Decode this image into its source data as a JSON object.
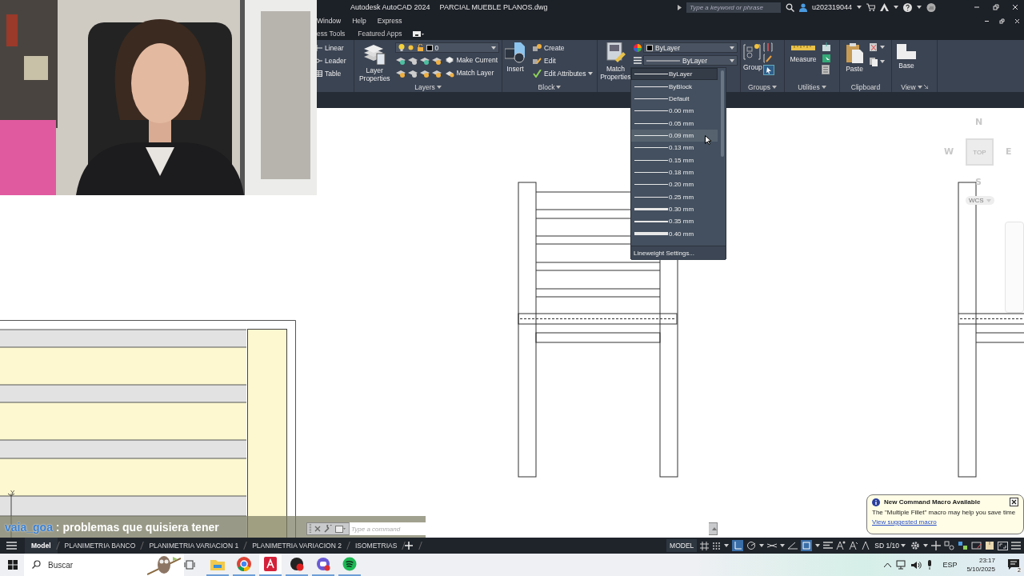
{
  "title_bar": {
    "app": "Autodesk AutoCAD 2024",
    "file": "PARCIAL MUEBLE PLANOS.dwg",
    "search": {
      "placeholder": "Type a keyword or phrase"
    },
    "user": "u202319044"
  },
  "menu": [
    "Window",
    "Help",
    "Express"
  ],
  "ribbon_tabs": [
    {
      "label": "ess Tools",
      "selected": false
    },
    {
      "label": "Featured Apps",
      "selected": false
    }
  ],
  "ribbon": {
    "annotation": {
      "tools": [
        "Linear",
        "Leader",
        "Table"
      ]
    },
    "layers": {
      "title": "Layers",
      "properties": "Layer Properties",
      "layer": "0",
      "make_current": "Make Current",
      "match_layer": "Match Layer"
    },
    "block": {
      "title": "Block",
      "insert": "Insert",
      "tools": [
        "Create",
        "Edit",
        "Edit Attributes"
      ]
    },
    "properties": {
      "match": "Match Properties",
      "color_setting": "ByLayer",
      "lineweight": "ByLayer"
    },
    "groups": {
      "title": "Groups",
      "group": "Group"
    },
    "utilities": {
      "title": "Utilities",
      "measure": "Measure"
    },
    "clipboard": {
      "title": "Clipboard",
      "paste": "Paste"
    },
    "view": {
      "title": "View",
      "base": "Base"
    }
  },
  "lineweight_menu": {
    "items": [
      {
        "label": "ByLayer",
        "kind": "thin",
        "selected": true,
        "hovered": false
      },
      {
        "label": "ByBlock",
        "kind": "thin",
        "selected": false,
        "hovered": false
      },
      {
        "label": "Default",
        "kind": "thin",
        "selected": false,
        "hovered": false
      },
      {
        "label": "0.00 mm",
        "kind": "thin",
        "selected": false,
        "hovered": false
      },
      {
        "label": "0.05 mm",
        "kind": "thin",
        "selected": false,
        "hovered": false
      },
      {
        "label": "0.09 mm",
        "kind": "thin",
        "selected": false,
        "hovered": true
      },
      {
        "label": "0.13 mm",
        "kind": "thin",
        "selected": false,
        "hovered": false
      },
      {
        "label": "0.15 mm",
        "kind": "thin",
        "selected": false,
        "hovered": false
      },
      {
        "label": "0.18 mm",
        "kind": "thin",
        "selected": false,
        "hovered": false
      },
      {
        "label": "0.20 mm",
        "kind": "thin",
        "selected": false,
        "hovered": false
      },
      {
        "label": "0.25 mm",
        "kind": "thin",
        "selected": false,
        "hovered": false
      },
      {
        "label": "0.30 mm",
        "kind": "bold",
        "selected": false,
        "hovered": false
      },
      {
        "label": "0.35 mm",
        "kind": "bold",
        "selected": false,
        "hovered": false
      },
      {
        "label": "0.40 mm",
        "kind": "heavy",
        "selected": false,
        "hovered": false
      }
    ],
    "footer": "Lineweight Settings..."
  },
  "viewcube": {
    "north": "N",
    "west": "W",
    "face": "TOP",
    "east": "E",
    "south": "S",
    "ucs": "WCS"
  },
  "ucs_icon": {
    "axis": "Y"
  },
  "chat": {
    "user": "vaia_goa",
    "message": ": problemas que quisiera tener"
  },
  "command_line": {
    "placeholder": "Type a command"
  },
  "notification": {
    "title": "New Command Macro Available",
    "body": "The \"Multiple Fillet\" macro may help you save time",
    "link": "View suggested macro"
  },
  "layout_tabs": [
    {
      "label": "Model",
      "selected": true
    },
    {
      "label": "PLANIMETRIA BANCO",
      "selected": false
    },
    {
      "label": "PLANIMETRIA VARIACION 1",
      "selected": false
    },
    {
      "label": "PLANIMETRIA VARIACION 2",
      "selected": false
    },
    {
      "label": "ISOMETRIAS",
      "selected": false
    }
  ],
  "status_bar": {
    "space": "MODEL",
    "scale": "SD 1/10"
  },
  "taskbar": {
    "search": {
      "placeholder": "Buscar"
    },
    "language": "ESP",
    "time": "23:17",
    "date": "5/10/2025",
    "notifications": "2"
  }
}
